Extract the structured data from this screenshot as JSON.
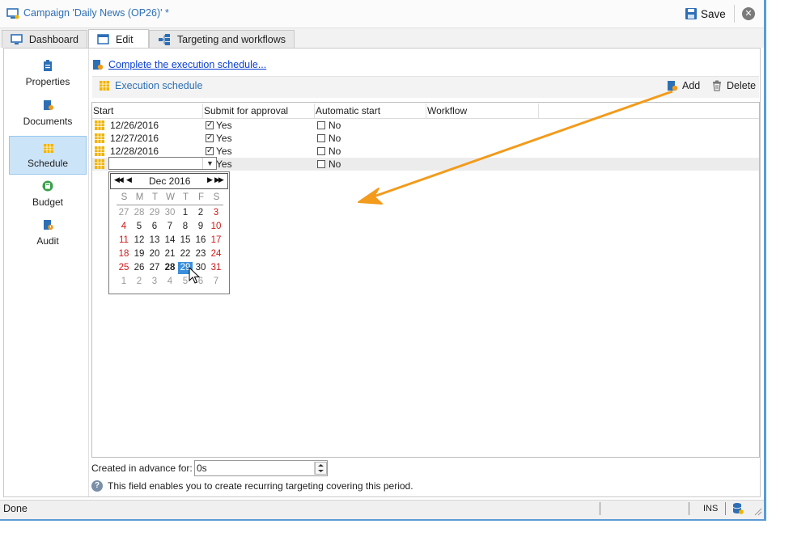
{
  "window": {
    "title": "Campaign 'Daily News (OP26)' *",
    "save_label": "Save"
  },
  "tabs": [
    {
      "label": "Dashboard",
      "icon": "dashboard-icon"
    },
    {
      "label": "Edit",
      "icon": "edit-icon"
    },
    {
      "label": "Targeting and workflows",
      "icon": "workflow-icon"
    }
  ],
  "active_tab": "Edit",
  "sidebar": {
    "items": [
      {
        "label": "Properties",
        "icon": "properties-icon"
      },
      {
        "label": "Documents",
        "icon": "documents-icon"
      },
      {
        "label": "Schedule",
        "icon": "schedule-icon"
      },
      {
        "label": "Budget",
        "icon": "budget-icon"
      },
      {
        "label": "Audit",
        "icon": "audit-icon"
      }
    ],
    "active": "Schedule"
  },
  "main": {
    "link_text": "Complete the execution schedule...",
    "toolbar": {
      "schedule_label": "Execution schedule",
      "add_label": "Add",
      "delete_label": "Delete"
    },
    "columns": [
      "Start",
      "Submit for approval",
      "Automatic start",
      "Workflow"
    ],
    "rows": [
      {
        "start": "12/26/2016",
        "submit": "Yes",
        "submit_checked": true,
        "auto": "No",
        "auto_checked": false
      },
      {
        "start": "12/27/2016",
        "submit": "Yes",
        "submit_checked": true,
        "auto": "No",
        "auto_checked": false
      },
      {
        "start": "12/28/2016",
        "submit": "Yes",
        "submit_checked": true,
        "auto": "No",
        "auto_checked": false
      },
      {
        "start": "",
        "submit": "Yes",
        "submit_checked": false,
        "auto": "No",
        "auto_checked": false
      }
    ],
    "calendar": {
      "month_label": "Dec 2016",
      "weekdays": [
        "S",
        "M",
        "T",
        "W",
        "T",
        "F",
        "S"
      ],
      "weeks": [
        [
          "27",
          "28",
          "29",
          "30",
          "1",
          "2",
          "3"
        ],
        [
          "4",
          "5",
          "6",
          "7",
          "8",
          "9",
          "10"
        ],
        [
          "11",
          "12",
          "13",
          "14",
          "15",
          "16",
          "17"
        ],
        [
          "18",
          "19",
          "20",
          "21",
          "22",
          "23",
          "24"
        ],
        [
          "25",
          "26",
          "27",
          "28",
          "29",
          "30",
          "31"
        ],
        [
          "1",
          "2",
          "3",
          "4",
          "5",
          "6",
          "7"
        ]
      ],
      "today": "28",
      "selected": "29"
    },
    "advance": {
      "label": "Created in advance for:",
      "value": "0s"
    },
    "help_text": "This field enables you to create recurring targeting covering this period."
  },
  "status": {
    "text": "Done",
    "mode": "INS"
  },
  "colors": {
    "accent": "#2d6fb5",
    "link": "#0b3fd1",
    "window_border": "#5b9bd5",
    "selected_nav": "#cce4f7",
    "weekend": "#d01919",
    "calendar_selected": "#3b8fdc",
    "annotation_arrow": "#f29b1c",
    "schedule_icon": "#f0b400"
  }
}
